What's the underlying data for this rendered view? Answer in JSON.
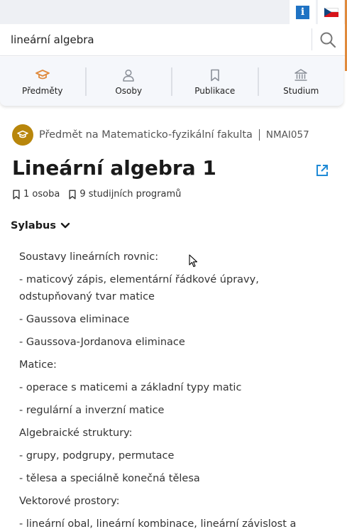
{
  "header": {
    "info_label": "i",
    "lang_flag": "czech-flag"
  },
  "search": {
    "value": "lineární algebra",
    "placeholder": ""
  },
  "nav": {
    "items": [
      {
        "label": "Předměty",
        "icon": "graduation-cap-icon",
        "active": true
      },
      {
        "label": "Osoby",
        "icon": "person-icon"
      },
      {
        "label": "Publikace",
        "icon": "bookmark-icon"
      },
      {
        "label": "Studium",
        "icon": "institution-icon"
      }
    ]
  },
  "subject": {
    "kind": "Předmět na Matematicko-fyzikální fakulta",
    "code": "NMAI057",
    "title": "Lineární algebra 1",
    "persons": "1 osoba",
    "programs": "9 studijních programů"
  },
  "sylabus": {
    "label": "Sylabus",
    "lines": [
      "Soustavy lineárních rovnic:",
      "- maticový zápis, elementární řádkové úpravy, odstupňovaný tvar matice",
      "- Gaussova eliminace",
      "- Gaussova-Jordanova eliminace",
      "Matice:",
      "- operace s maticemi a základní typy matic",
      "- regulární a inverzní matice",
      "Algebraické struktury:",
      "- grupy, podgrupy, permutace",
      "- tělesa a speciálně konečná tělesa",
      "Vektorové prostory:",
      "- lineární obal, lineární kombinace, lineární závislost a"
    ]
  },
  "colors": {
    "accent": "#e08a3c",
    "subject_badge": "#b8860b",
    "info_blue": "#1f73c4",
    "link_blue": "#1f8ad6"
  }
}
